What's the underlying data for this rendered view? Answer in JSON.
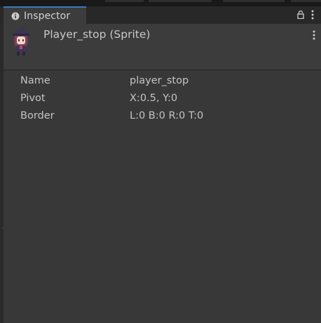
{
  "window": {
    "tab_title": "Inspector",
    "tab_icon": "info-icon",
    "tool_icons": [
      "lock-icon",
      "kebab-menu-icon"
    ]
  },
  "header": {
    "title": "Player_stop (Sprite)",
    "thumbnail_icon": "sprite-thumbnail",
    "menu_icon": "kebab-menu-icon"
  },
  "properties": [
    {
      "label": "Name",
      "value": "player_stop"
    },
    {
      "label": "Pivot",
      "value": "X:0.5, Y:0"
    },
    {
      "label": "Border",
      "value": "L:0 B:0 R:0 T:0"
    }
  ],
  "colors": {
    "accent": "#3a79bb",
    "panel_bg": "#383838",
    "header_bg": "#3c3c3c",
    "tabbar_bg": "#282828",
    "text": "#c4c4c4"
  }
}
